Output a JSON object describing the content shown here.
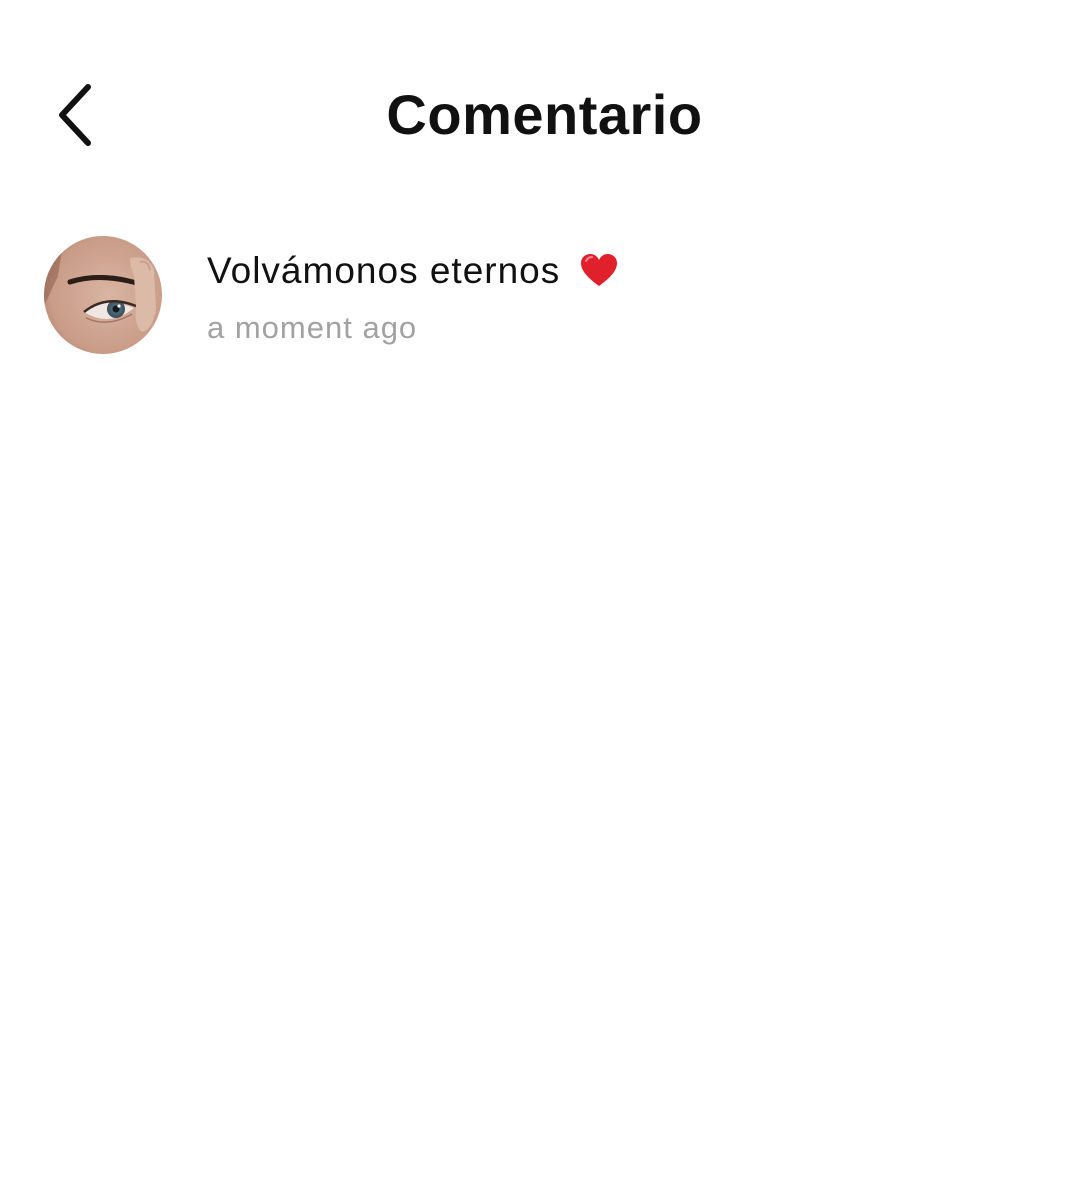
{
  "header": {
    "title": "Comentario",
    "back_icon": "chevron-left-icon"
  },
  "comments": [
    {
      "avatar_icon": "user-avatar-eye-photo",
      "text": "Volvámonos eternos",
      "emoji_icon": "red-heart-icon",
      "emoji_color": "#e0202a",
      "timestamp": "a moment ago"
    }
  ],
  "colors": {
    "background": "#ffffff",
    "text": "#111111",
    "secondary_text": "#a2a2a2"
  }
}
